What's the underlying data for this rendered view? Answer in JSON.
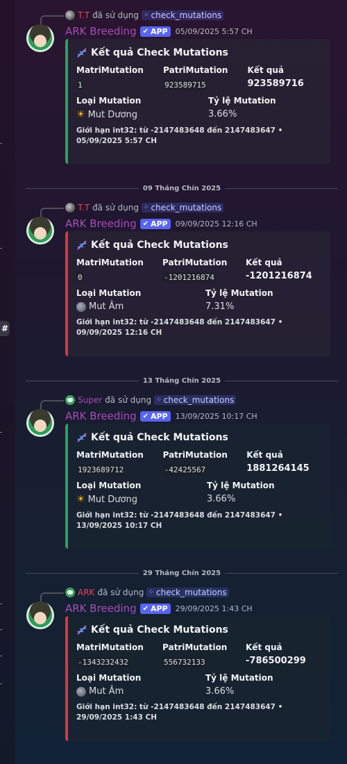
{
  "sidebar": {
    "channel_icon": "#"
  },
  "command_name": "check_mutations",
  "used_text": "đã sử dụng",
  "bot_name": "ARK Breeding",
  "app_label": "APP",
  "embed_title": "Kết quả Check Mutations",
  "field_labels": {
    "matri": "MatriMutation",
    "patri": "PatriMutation",
    "result": "Kết quả",
    "type": "Loại Mutation",
    "rate": "Tỷ lệ Mutation"
  },
  "dividers": [
    "09 Tháng Chín 2025",
    "13 Tháng Chín 2025",
    "29 Tháng Chín 2025"
  ],
  "messages": [
    {
      "reply_user": "T.T",
      "reply_user_color": "#e0485a",
      "timestamp": "05/09/2025 5:57 CH",
      "matri": "1",
      "patri": "923589715",
      "result": "923589716",
      "type": "Mut Dương",
      "type_icon": "sun-icon",
      "rate": "3.66%",
      "footer": "Giới hạn int32: từ -2147483648 đến 2147483647 • 05/09/2025 5:57 CH",
      "accent": "#23a55a"
    },
    {
      "reply_user": "T.T",
      "reply_user_color": "#e0485a",
      "timestamp": "09/09/2025 12:16 CH",
      "matri": "0",
      "patri": "-1201216874",
      "result": "-1201216874",
      "type": "Mut Âm",
      "type_icon": "moon-icon",
      "rate": "7.31%",
      "footer": "Giới hạn int32: từ -2147483648 đến 2147483647 • 09/09/2025 12:16 CH",
      "accent": "#da373c"
    },
    {
      "reply_user": "Super",
      "reply_user_color": "#a64db8",
      "timestamp": "13/09/2025 10:17 CH",
      "matri": "1923689712",
      "patri": "-42425567",
      "result": "1881264145",
      "type": "Mut Dương",
      "type_icon": "sun-icon",
      "rate": "3.66%",
      "footer": "Giới hạn int32: từ -2147483648 đến 2147483647 • 13/09/2025 10:17 CH",
      "accent": "#23a55a"
    },
    {
      "reply_user": "ARK",
      "reply_user_color": "#e0485a",
      "timestamp": "29/09/2025 1:43 CH",
      "matri": "-1343232432",
      "patri": "556732133",
      "result": "-786500299",
      "type": "Mut Âm",
      "type_icon": "moon-icon",
      "rate": "3.66%",
      "footer": "Giới hạn int32: từ -2147483648 đến 2147483647 • 29/09/2025 1:43 CH",
      "accent": "#da373c"
    }
  ]
}
